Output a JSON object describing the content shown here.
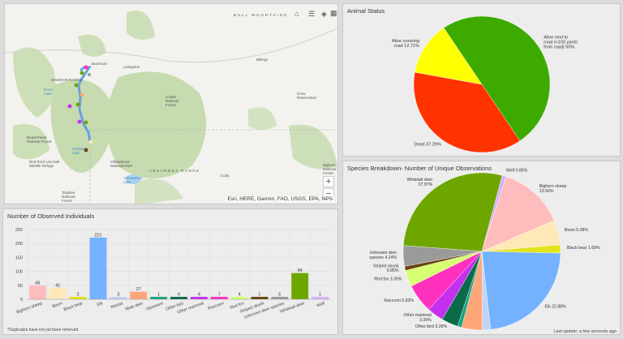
{
  "map": {
    "attribution": "Esri, HERE, Garmin, FAO, USGS, EPA, NPS",
    "zoom_in": "+",
    "zoom_out": "−",
    "toolbar_icons": [
      "home-icon",
      "layer-list-icon",
      "basemap-icon",
      "grid-icon"
    ],
    "labels": {
      "bull_mountains": "BULL MOUNTAINS",
      "bozeman": "Bozeman",
      "livingston": "Livingston",
      "billings": "Billings",
      "madison_range": "MADISON RANGE",
      "cody": "Cody",
      "absaroka": "ABSAROKA RANGE",
      "yellowstone_lake": "Yellowstone Lake",
      "custer": "Custer National Forest",
      "crow": "Crow Reservation",
      "ynp": "Yellowstone National Park",
      "beaverhead": "Beaverhead National Forest",
      "red_rock": "Red Rock Lks Natl Wildlife Refuge",
      "targhee": "Targhee National Forest",
      "bighorn": "Bighorn National Forest",
      "ennis": "Ennis Lake",
      "hebgen": "Hebgen Lake"
    }
  },
  "bars": {
    "title": "Number of Observed Individuals",
    "footnote": "*Duplicates have not yet been removed",
    "chart_data": {
      "type": "bar",
      "categories": [
        "Bighorn sheep",
        "Bison",
        "Black bear",
        "Elk",
        "Moose",
        "Mule deer",
        "Opossum",
        "Other bird",
        "Other mammal",
        "Raccoon",
        "Red fox",
        "Striped skunk",
        "Unknown deer species",
        "Whitetail deer",
        "Wolf"
      ],
      "values": [
        49,
        41,
        2,
        221,
        3,
        27,
        1,
        6,
        4,
        7,
        4,
        1,
        5,
        94,
        1
      ],
      "colors": [
        "#ffbcbc",
        "#ffe8b8",
        "#e3e31c",
        "#74b2ff",
        "#c2d4f4",
        "#ffa679",
        "#17a585",
        "#0b6a47",
        "#c430ee",
        "#ff30be",
        "#d6ff72",
        "#6b4412",
        "#9a9a9a",
        "#6ea600",
        "#d6b2ff"
      ],
      "yticks": [
        0,
        50,
        100,
        150,
        200,
        250
      ],
      "ylim": [
        0,
        250
      ],
      "grid": true
    }
  },
  "status": {
    "title": "Animal Status",
    "chart_data": {
      "type": "pie",
      "slices": [
        {
          "label": [
            "Alive next to",
            "road (<100 yards",
            "from road) 50%"
          ],
          "value": 50,
          "color": "#3daa00"
        },
        {
          "label": [
            "Dead 37.29%"
          ],
          "value": 37.29,
          "color": "#ff3300"
        },
        {
          "label": [
            "Alive crossing",
            "road 12.71%"
          ],
          "value": 12.71,
          "color": "#ffff00"
        }
      ]
    }
  },
  "species": {
    "title": "Species Breakdown- Number of Unique Observations",
    "last_update": "Last update: a few seconds ago",
    "chart_data": {
      "type": "pie",
      "slices": [
        {
          "label": [
            "Wolf 0.85%"
          ],
          "value": 0.85,
          "color": "#d6b2ff"
        },
        {
          "label": [
            "Bighorn sheep",
            "13.56%"
          ],
          "value": 13.56,
          "color": "#ffbcbc"
        },
        {
          "label": [
            "Bison 5.08%"
          ],
          "value": 5.08,
          "color": "#ffe8b8"
        },
        {
          "label": [
            "Black bear 1.69%"
          ],
          "value": 1.69,
          "color": "#e3e31c"
        },
        {
          "label": [
            "Elk 22.88%"
          ],
          "value": 22.88,
          "color": "#74b2ff"
        },
        {
          "label": [],
          "value": 1.69,
          "color": "#c2d4f4"
        },
        {
          "label": [],
          "value": 4.24,
          "color": "#ffa679"
        },
        {
          "label": [],
          "value": 0.85,
          "color": "#17a585"
        },
        {
          "label": [
            "Other bird 3.39%"
          ],
          "value": 3.39,
          "color": "#0b6a47"
        },
        {
          "label": [
            "Other mammal",
            "3.39%"
          ],
          "value": 3.39,
          "color": "#c430ee"
        },
        {
          "label": [
            "Raccoon 5.93%"
          ],
          "value": 5.93,
          "color": "#ff30be"
        },
        {
          "label": [
            "Red fox 3.39%"
          ],
          "value": 3.39,
          "color": "#d6ff72"
        },
        {
          "label": [
            "Striped skunk",
            "0.85%"
          ],
          "value": 0.85,
          "color": "#6b4412"
        },
        {
          "label": [
            "Unknown deer",
            "species 4.24%"
          ],
          "value": 4.24,
          "color": "#9a9a9a"
        },
        {
          "label": [
            "Whitetail deer",
            "27.97%"
          ],
          "value": 27.97,
          "color": "#6ea600"
        }
      ]
    }
  }
}
